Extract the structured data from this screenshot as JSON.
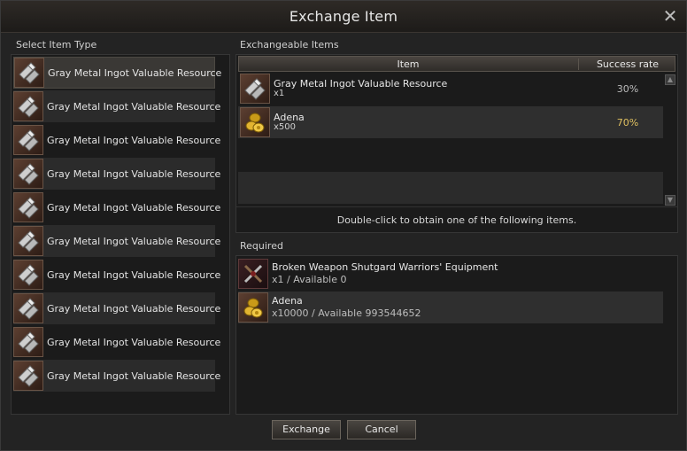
{
  "window": {
    "title": "Exchange Item",
    "close_glyph": "✕"
  },
  "left": {
    "label": "Select Item Type",
    "items": [
      {
        "label": "Gray Metal Ingot Valuable Resource",
        "icon": "metal-ingot-icon"
      },
      {
        "label": "Gray Metal Ingot Valuable Resource",
        "icon": "metal-ingot-icon"
      },
      {
        "label": "Gray Metal Ingot Valuable Resource",
        "icon": "metal-ingot-icon"
      },
      {
        "label": "Gray Metal Ingot Valuable Resource",
        "icon": "metal-ingot-icon"
      },
      {
        "label": "Gray Metal Ingot Valuable Resource",
        "icon": "metal-ingot-icon"
      },
      {
        "label": "Gray Metal Ingot Valuable Resource",
        "icon": "metal-ingot-icon"
      },
      {
        "label": "Gray Metal Ingot Valuable Resource",
        "icon": "metal-ingot-icon"
      },
      {
        "label": "Gray Metal Ingot Valuable Resource",
        "icon": "metal-ingot-icon"
      },
      {
        "label": "Gray Metal Ingot Valuable Resource",
        "icon": "metal-ingot-icon"
      },
      {
        "label": "Gray Metal Ingot Valuable Resource",
        "icon": "metal-ingot-icon"
      }
    ]
  },
  "exchangeable": {
    "label": "Exchangeable Items",
    "columns": {
      "item": "Item",
      "rate": "Success rate"
    },
    "rows": [
      {
        "name": "Gray Metal Ingot Valuable Resource",
        "qty": "x1",
        "rate": "30%",
        "icon": "metal-ingot-icon"
      },
      {
        "name": "Adena",
        "qty": "x500",
        "rate": "70%",
        "icon": "adena-coins-icon"
      }
    ],
    "hint": "Double-click to obtain one of the following items."
  },
  "required": {
    "label": "Required",
    "rows": [
      {
        "name": "Broken Weapon Shutgard Warriors' Equipment",
        "qty": "x1 / Available 0",
        "icon": "broken-weapon-icon"
      },
      {
        "name": "Adena",
        "qty": "x10000 / Available 993544652",
        "icon": "adena-coins-icon"
      }
    ]
  },
  "buttons": {
    "exchange": "Exchange",
    "cancel": "Cancel"
  },
  "colors": {
    "highlight_rate": "#e0c060",
    "panel_bg": "#1b1b1b",
    "window_bg": "#232323"
  }
}
